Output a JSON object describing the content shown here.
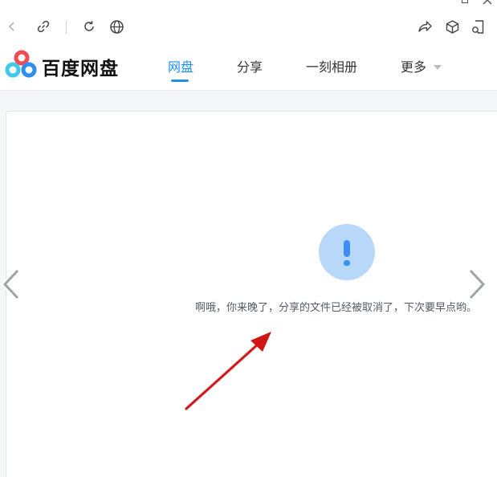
{
  "window": {
    "controls": [
      "maximize-icon",
      "close-icon"
    ]
  },
  "toolbar": {
    "icons": [
      "back-icon",
      "link-icon",
      "refresh-icon",
      "globe-icon",
      "share-icon",
      "box-icon",
      "document-icon"
    ]
  },
  "header": {
    "logo_text": "百度网盘",
    "tabs": [
      {
        "label": "网盘",
        "active": true
      },
      {
        "label": "分享",
        "active": false
      },
      {
        "label": "一刻相册",
        "active": false
      },
      {
        "label": "更多",
        "active": false,
        "has_dropdown": true
      }
    ]
  },
  "content": {
    "notice_icon": "exclamation-icon",
    "message": "啊哦，你来晚了，分享的文件已经被取消了，下次要早点哟。"
  },
  "colors": {
    "accent": "#1f8ef1",
    "notice_circle": "#b8d8fa",
    "notice_mark": "#3b8ff3",
    "annotation_arrow": "#d11515",
    "logo_blue": "#2f8cf0",
    "logo_red": "#ee4b54",
    "logo_cyan": "#40c9e8"
  }
}
